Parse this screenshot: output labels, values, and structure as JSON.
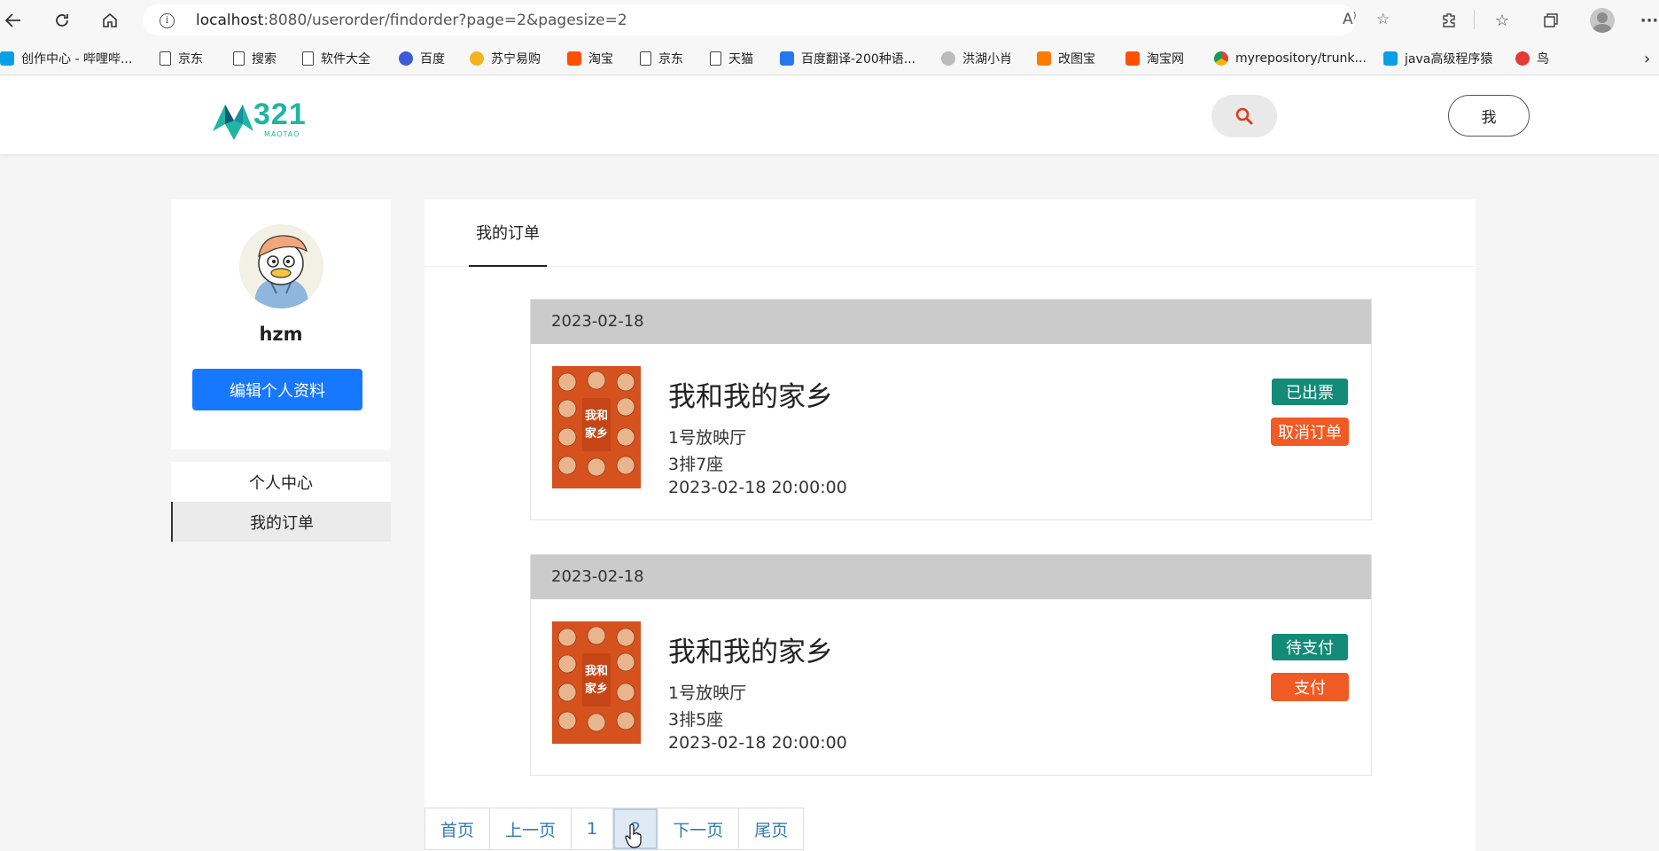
{
  "browser": {
    "url_host": "localhost",
    "url_rest": ":8080/userorder/findorder?page=2&pagesize=2",
    "bookmarks": [
      {
        "label": "创作中心 - 哔哩哔...",
        "icon": "bilibili-icon"
      },
      {
        "label": "京东",
        "icon": "document-icon"
      },
      {
        "label": "搜索",
        "icon": "document-icon"
      },
      {
        "label": "软件大全",
        "icon": "document-icon"
      },
      {
        "label": "百度",
        "icon": "baidu-icon"
      },
      {
        "label": "苏宁易购",
        "icon": "suning-icon"
      },
      {
        "label": "淘宝",
        "icon": "taobao-icon"
      },
      {
        "label": "京东",
        "icon": "document-icon"
      },
      {
        "label": "天猫",
        "icon": "document-icon"
      },
      {
        "label": "百度翻译-200种语...",
        "icon": "translate-icon"
      },
      {
        "label": "洪湖小肖",
        "icon": "bird-icon"
      },
      {
        "label": "改图宝",
        "icon": "gaitubao-icon"
      },
      {
        "label": "淘宝网",
        "icon": "taobao-icon"
      },
      {
        "label": "myrepository/trunk...",
        "icon": "chrome-icon"
      },
      {
        "label": "java高级程序猿",
        "icon": "bilibili-icon"
      },
      {
        "label": "鸟",
        "icon": "bird-icon"
      }
    ]
  },
  "header": {
    "logo_text": "321",
    "logo_sub": "MAOTAO",
    "me_label": "我"
  },
  "profile": {
    "username": "hzm",
    "edit_label": "编辑个人资料"
  },
  "side_menu": {
    "items": [
      {
        "label": "个人中心",
        "active": false
      },
      {
        "label": "我的订单",
        "active": true
      }
    ]
  },
  "main": {
    "tab_label": "我的订单",
    "orders": [
      {
        "date": "2023-02-18",
        "title": "我和我的家乡",
        "hall": "1号放映厅",
        "seat": "3排7座",
        "showtime": "2023-02-18 20:00:00",
        "status": "已出票",
        "action": "取消订单"
      },
      {
        "date": "2023-02-18",
        "title": "我和我的家乡",
        "hall": "1号放映厅",
        "seat": "3排5座",
        "showtime": "2023-02-18 20:00:00",
        "status": "待支付",
        "action": "支付"
      }
    ]
  },
  "pagination": {
    "first": "首页",
    "prev": "上一页",
    "page1": "1",
    "page2": "2",
    "next": "下一页",
    "last": "尾页"
  },
  "colors": {
    "primary": "#1677ff",
    "status_green": "#138b77",
    "action_orange": "#f05a24",
    "logo_teal": "#1fb5a2",
    "link_blue": "#337ab7"
  }
}
